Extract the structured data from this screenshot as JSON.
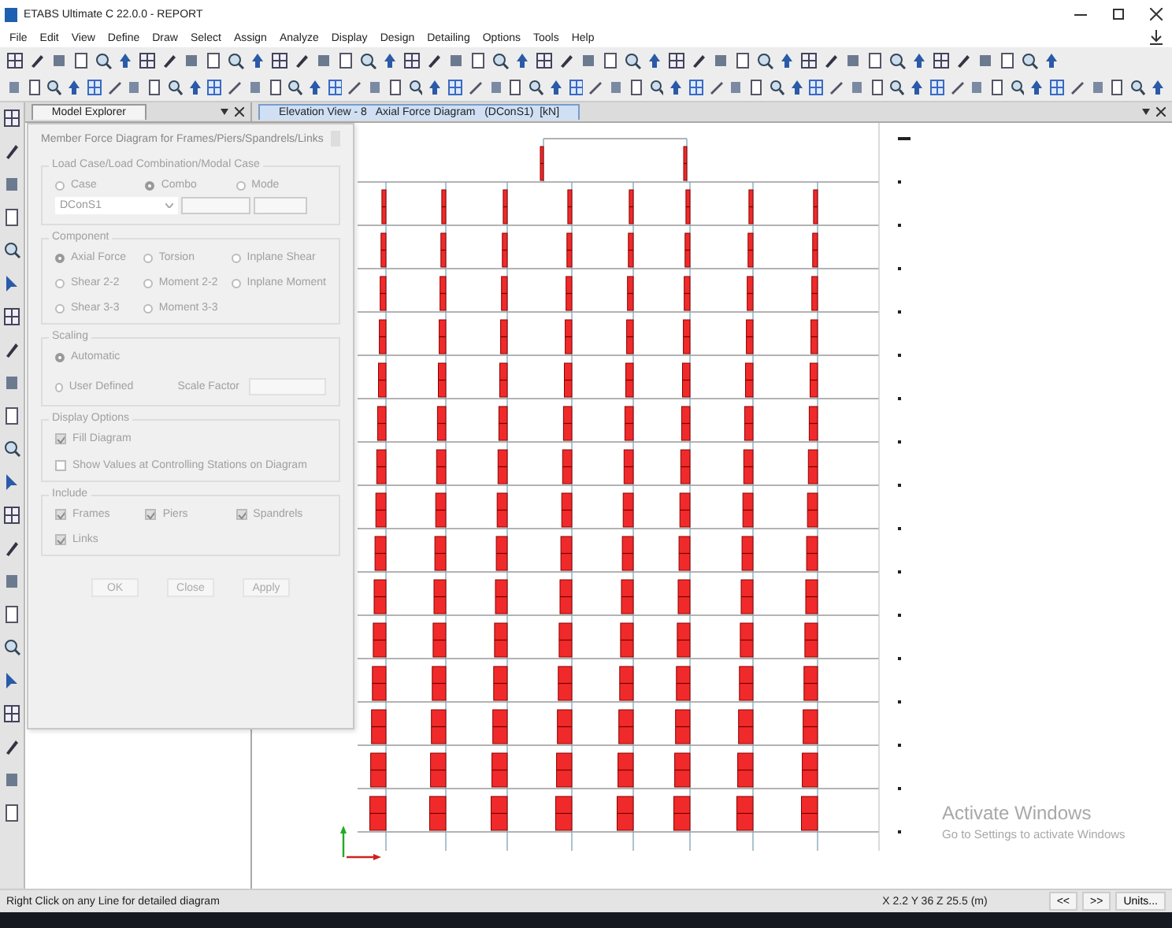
{
  "window": {
    "title": "ETABS Ultimate C 22.0.0 - REPORT"
  },
  "menu": [
    "File",
    "Edit",
    "View",
    "Define",
    "Draw",
    "Select",
    "Assign",
    "Analyze",
    "Display",
    "Design",
    "Detailing",
    "Options",
    "Tools",
    "Help"
  ],
  "explorer": {
    "title": "Model Explorer"
  },
  "view_tab": {
    "title": "Elevation View - 8   Axial Force Diagram   (DConS1)  [kN]"
  },
  "dialog": {
    "title": "Member Force Diagram for Frames/Piers/Spandrels/Links",
    "groups": [
      {
        "label": "Load Case/Load Combination/Modal Case",
        "kind": "columns",
        "dropdown": "DConS1",
        "items": [
          {
            "kind": "radio",
            "label": "Case",
            "selected": false
          },
          {
            "kind": "radio",
            "label": "Combo",
            "selected": true
          },
          {
            "kind": "radio",
            "label": "Mode",
            "selected": false
          }
        ]
      },
      {
        "label": "Component",
        "kind": "columns",
        "items": [
          {
            "kind": "radio",
            "label": "Axial Force",
            "selected": true
          },
          {
            "kind": "radio",
            "label": "Torsion",
            "selected": false
          },
          {
            "kind": "radio",
            "label": "Inplane Shear",
            "selected": false
          },
          {
            "kind": "radio",
            "label": "Shear 2-2",
            "selected": false
          },
          {
            "kind": "radio",
            "label": "Moment 2-2",
            "selected": false
          },
          {
            "kind": "radio",
            "label": "Inplane Moment",
            "selected": false
          },
          {
            "kind": "radio",
            "label": "Shear 3-3",
            "selected": false
          },
          {
            "kind": "radio",
            "label": "Moment 3-3",
            "selected": false
          }
        ]
      },
      {
        "label": "Scaling",
        "kind": "rows",
        "items": [
          {
            "kind": "radio",
            "label": "Automatic",
            "selected": true
          },
          {
            "kind": "radio",
            "label": "User Defined",
            "selected": false,
            "field_label": "Scale Factor"
          }
        ]
      },
      {
        "label": "Display Options",
        "kind": "rows",
        "items": [
          {
            "kind": "checkbox",
            "label": "Fill Diagram",
            "checked": true
          },
          {
            "kind": "checkbox",
            "label": "Show Values at Controlling Stations on Diagram",
            "checked": false
          }
        ]
      },
      {
        "label": "Include",
        "kind": "columns",
        "items": [
          {
            "kind": "checkbox",
            "label": "Frames",
            "checked": true
          },
          {
            "kind": "checkbox",
            "label": "Piers",
            "checked": true
          },
          {
            "kind": "checkbox",
            "label": "Spandrels",
            "checked": true
          },
          {
            "kind": "checkbox",
            "label": "Links",
            "checked": true
          }
        ]
      }
    ],
    "buttons": [
      "OK",
      "Close",
      "Apply"
    ]
  },
  "activation_notice": {
    "title": "Activate Windows",
    "text": "Go to Settings to activate Windows"
  },
  "status_bar": {
    "hint": "Right Click on any Line for detailed diagram",
    "coordinates": "X 2.2  Y 36  Z 25.5 (m)",
    "buttons": [
      "<<",
      ">>",
      "Units..."
    ]
  }
}
